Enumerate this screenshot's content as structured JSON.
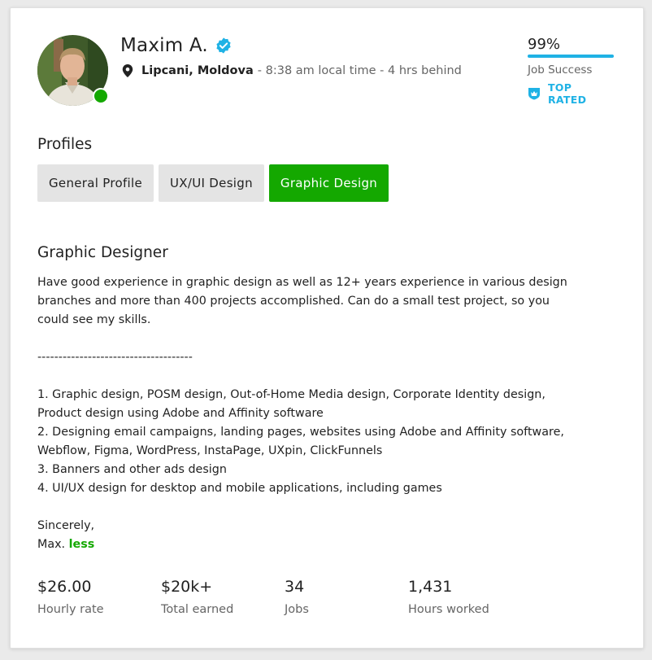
{
  "profile": {
    "name": "Maxim A.",
    "location_city": "Lipcani, Moldova",
    "location_time": "- 8:38 am local time - 4 hrs behind"
  },
  "job_success": {
    "percent": "99%",
    "percent_value": 99,
    "label": "Job Success",
    "badge": "TOP RATED"
  },
  "profiles": {
    "title": "Profiles",
    "tabs": [
      {
        "label": "General Profile",
        "active": false
      },
      {
        "label": "UX/UI Design",
        "active": false
      },
      {
        "label": "Graphic Design",
        "active": true
      }
    ]
  },
  "section": {
    "title": "Graphic Designer",
    "intro_1": "Have good experience in graphic design as well as 12+ years experience in various design",
    "intro_2": "branches and more than 400 projects accomplished. Can do a small test project, so you",
    "intro_3": "could see my skills.",
    "divider": "-------------------------------------",
    "item_1a": "1. Graphic design, POSM design, Out-of-Home Media design, Corporate Identity design,",
    "item_1b": "Product design using Adobe and Affinity software",
    "item_2a": "2. Designing email campaigns, landing pages, websites using Adobe and Affinity software,",
    "item_2b": "Webflow, Figma, WordPress, InstaPage, UXpin, ClickFunnels",
    "item_3": "3. Banners and other ads design",
    "item_4": "4. UI/UX design for desktop and mobile applications, including games",
    "sign_1": "Sincerely,",
    "sign_2": "Max.",
    "less_link": "less"
  },
  "stats": [
    {
      "value": "$26.00",
      "label": "Hourly rate"
    },
    {
      "value": "$20k+",
      "label": "Total earned"
    },
    {
      "value": "34",
      "label": "Jobs"
    },
    {
      "value": "1,431",
      "label": "Hours worked"
    }
  ],
  "colors": {
    "brand_green": "#14a800",
    "top_rated_blue": "#1fb2e5",
    "verified_blue": "#1fb2e5"
  }
}
